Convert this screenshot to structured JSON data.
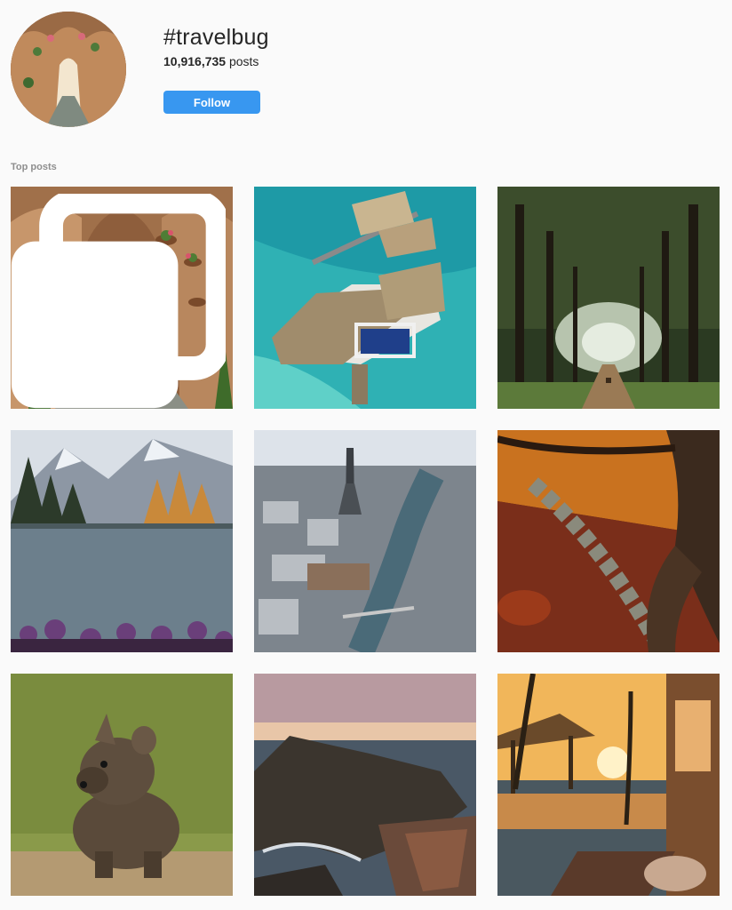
{
  "tag": {
    "name": "#travelbug"
  },
  "stats": {
    "posts_count": "10,916,735",
    "posts_label": "posts"
  },
  "actions": {
    "follow_label": "Follow"
  },
  "sections": {
    "top_posts_label": "Top posts"
  },
  "colors": {
    "follow_button": "#3897f0",
    "page_background": "#fafafa",
    "muted_text": "#8e8e8e"
  },
  "posts": [
    {
      "subject": "arched-alley-hanging-flower-pots",
      "multi_image": true
    },
    {
      "subject": "overwater-villas-turquoise-lagoon",
      "multi_image": false
    },
    {
      "subject": "tree-tunnel-road-with-deer",
      "multi_image": false
    },
    {
      "subject": "mountain-lake-reflection-purple-flowers",
      "multi_image": false
    },
    {
      "subject": "aerial-eiffel-tower-and-seine",
      "multi_image": false
    },
    {
      "subject": "autumn-forest-stone-stairs",
      "multi_image": false
    },
    {
      "subject": "hyena-cub",
      "multi_image": false
    },
    {
      "subject": "coastal-cliffs-at-sunset",
      "multi_image": false
    },
    {
      "subject": "tropical-beach-hut-infinity-pool-sunset",
      "multi_image": false
    }
  ]
}
